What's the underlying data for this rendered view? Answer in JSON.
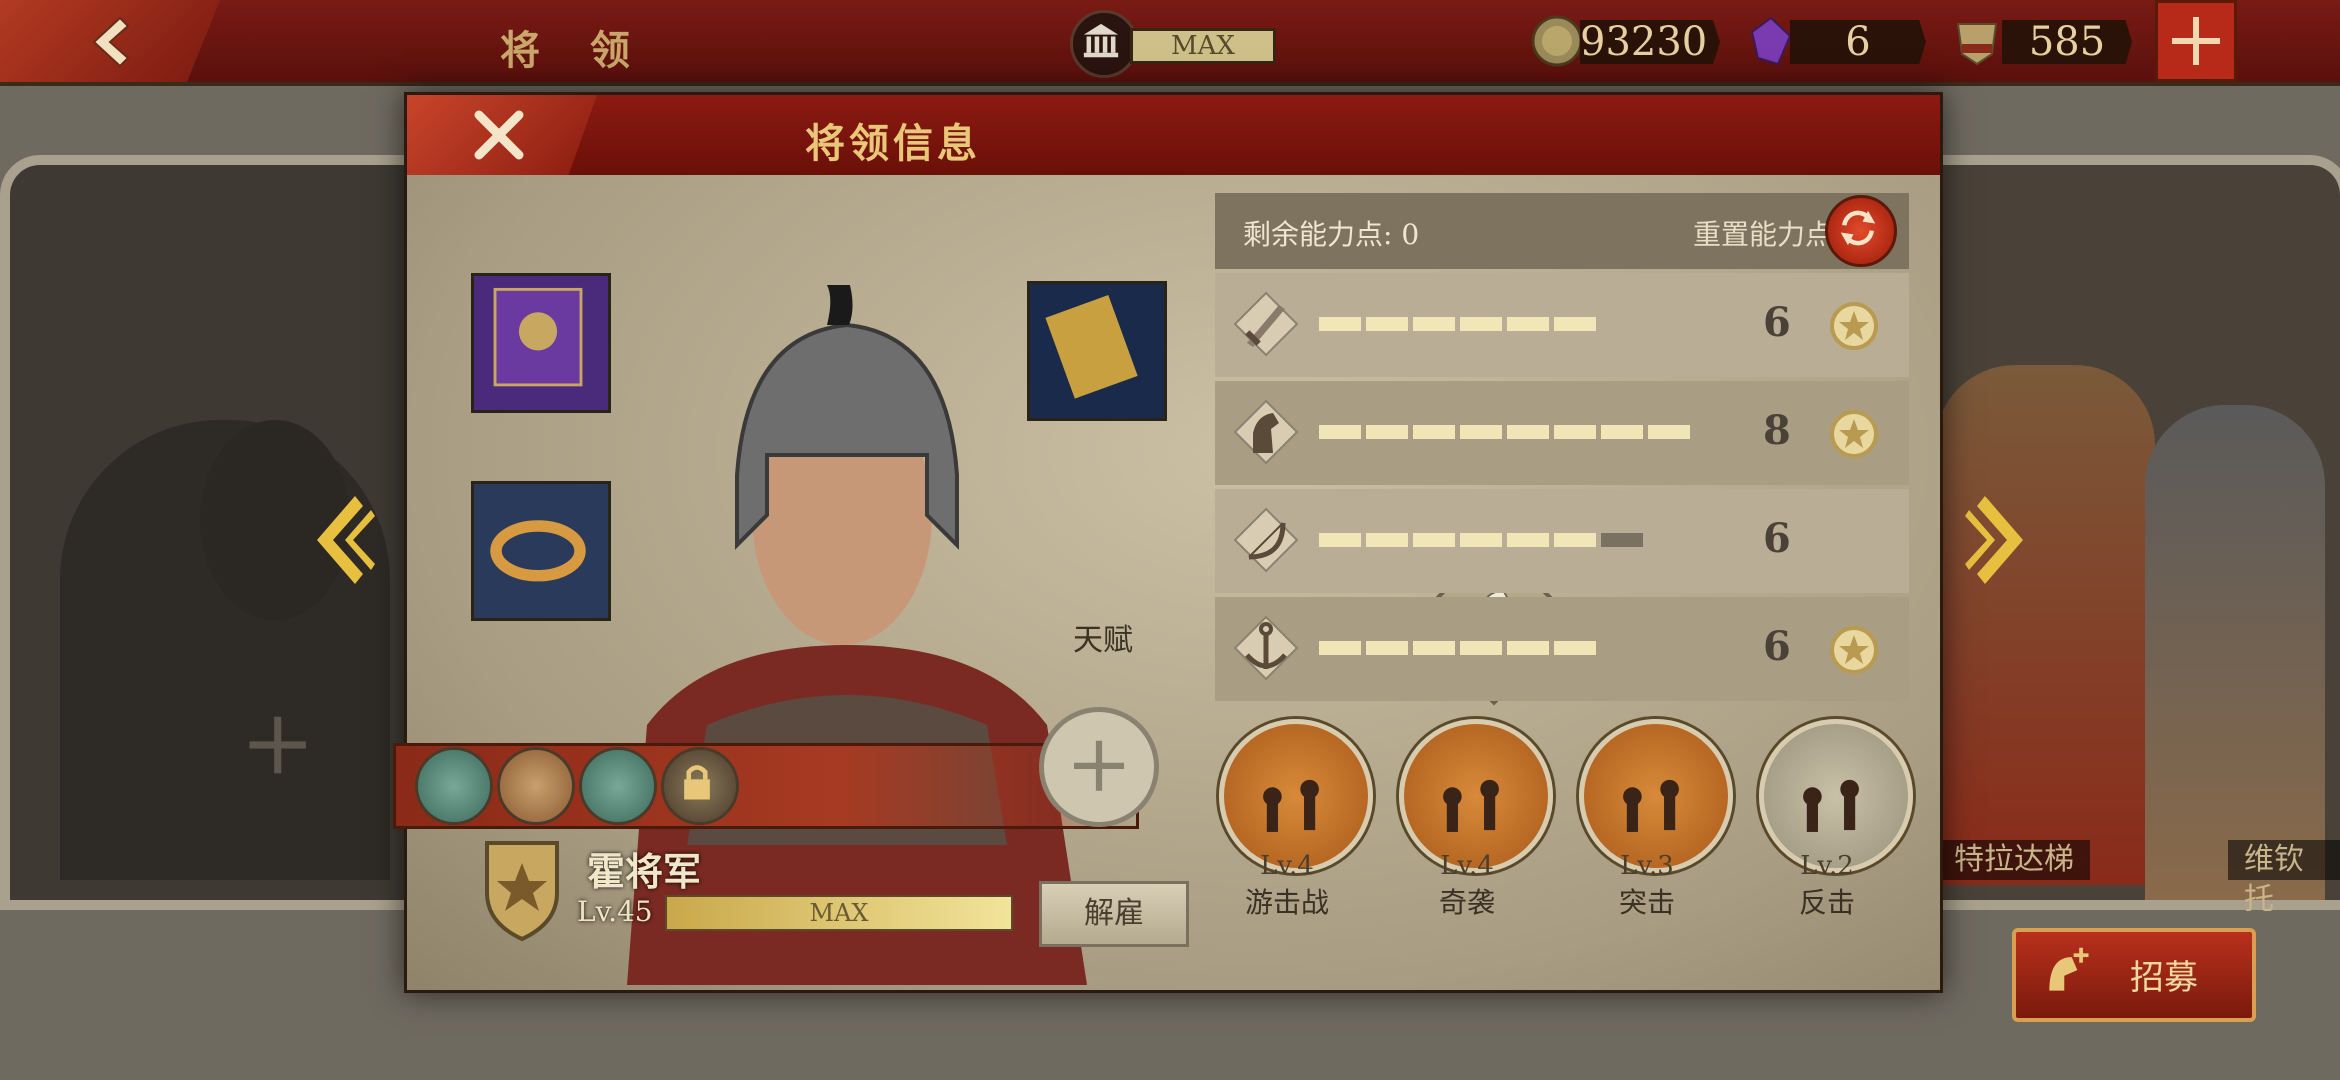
{
  "top_bar": {
    "title": "将 领",
    "building_level": "MAX",
    "coins": "93230",
    "gems": "6",
    "spqr": "585"
  },
  "side_heroes": {
    "right_names": [
      "特拉达梯",
      "维钦托"
    ]
  },
  "modal": {
    "title": "将领信息",
    "talent_label": "天赋",
    "hero": {
      "name": "霍将军",
      "level": "Lv.45",
      "xp_label": "MAX",
      "dismiss_label": "解雇"
    },
    "ability": {
      "remaining_label": "剩余能力点: 0",
      "reset_label": "重置能力点",
      "stats": [
        {
          "icon": "sword-icon",
          "value": "6",
          "filled": 6,
          "pending": 0,
          "medal": true
        },
        {
          "icon": "horse-icon",
          "value": "8",
          "filled": 8,
          "pending": 0,
          "medal": true
        },
        {
          "icon": "bow-icon",
          "value": "6",
          "filled": 6,
          "pending": 1,
          "medal": false
        },
        {
          "icon": "anchor-icon",
          "value": "6",
          "filled": 6,
          "pending": 0,
          "medal": true
        }
      ]
    },
    "skills": [
      {
        "level": "Lv.4",
        "name": "游击战"
      },
      {
        "level": "Lv.4",
        "name": "奇袭"
      },
      {
        "level": "Lv.3",
        "name": "突击"
      },
      {
        "level": "Lv.2",
        "name": "反击"
      }
    ]
  },
  "recruit_label": "招募",
  "colors": {
    "header_red": "#7a1a14",
    "gold": "#e8c878",
    "panel": "#b9ae95"
  }
}
